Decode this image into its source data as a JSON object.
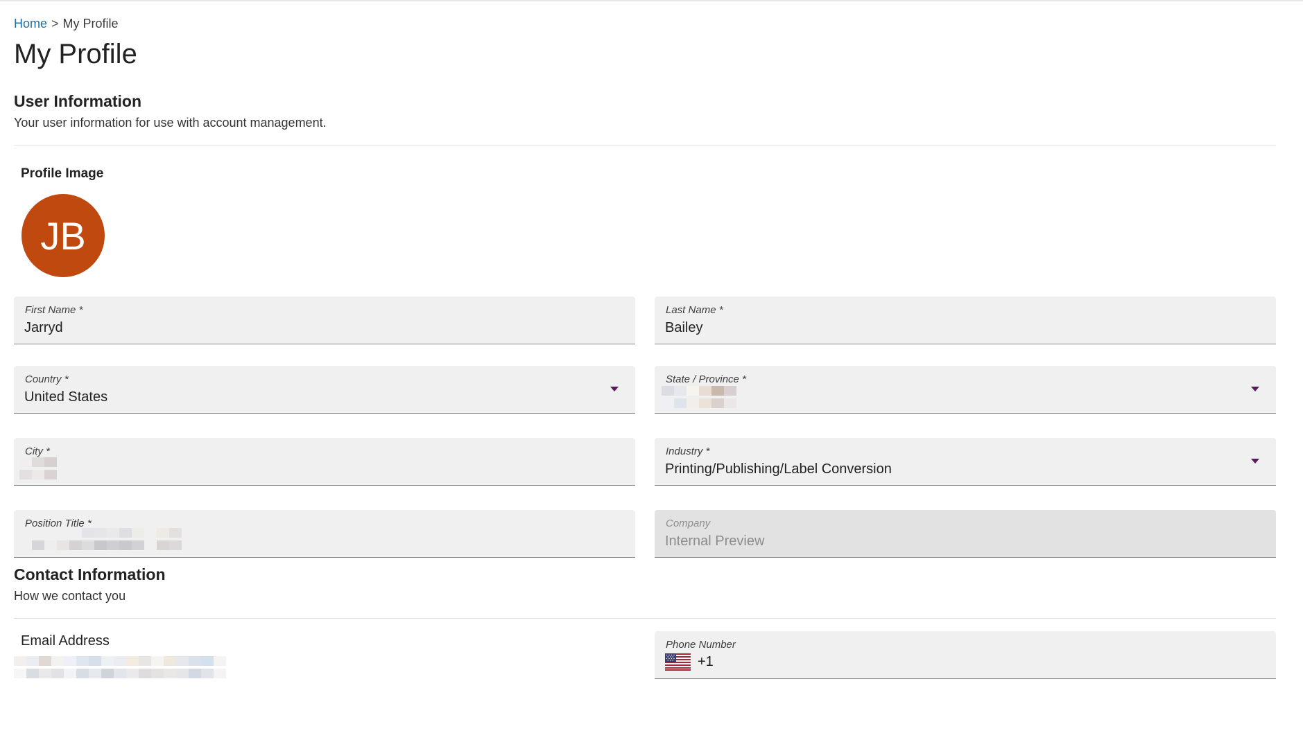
{
  "breadcrumb": {
    "home": "Home",
    "separator": ">",
    "current": "My Profile"
  },
  "page": {
    "title": "My Profile"
  },
  "user_info": {
    "title": "User Information",
    "subtitle": "Your user information for use with account management."
  },
  "profile_image": {
    "label": "Profile Image",
    "initials": "JB",
    "avatar_color": "#c0490f"
  },
  "fields": {
    "first_name": {
      "label": "First Name *",
      "value": "Jarryd"
    },
    "last_name": {
      "label": "Last Name *",
      "value": "Bailey"
    },
    "country": {
      "label": "Country *",
      "value": "United States",
      "icon": "chevron-down-icon"
    },
    "state": {
      "label": "State / Province *",
      "value": "",
      "icon": "chevron-down-icon"
    },
    "city": {
      "label": "City *",
      "value": ""
    },
    "industry": {
      "label": "Industry *",
      "value": "Printing/Publishing/Label Conversion",
      "icon": "chevron-down-icon"
    },
    "position_title": {
      "label": "Position Title *",
      "value": ""
    },
    "company": {
      "label": "Company",
      "value": "Internal Preview"
    }
  },
  "contact_info": {
    "title": "Contact Information",
    "subtitle": "How we contact you",
    "email_label": "Email Address",
    "phone": {
      "label": "Phone Number",
      "flag": "us-flag-icon",
      "prefix": "+1"
    }
  },
  "colors": {
    "link": "#1f6fa3",
    "accent_caret": "#5b1a5c",
    "field_bg": "#f0f0f0",
    "disabled_bg": "#e2e2e2"
  }
}
